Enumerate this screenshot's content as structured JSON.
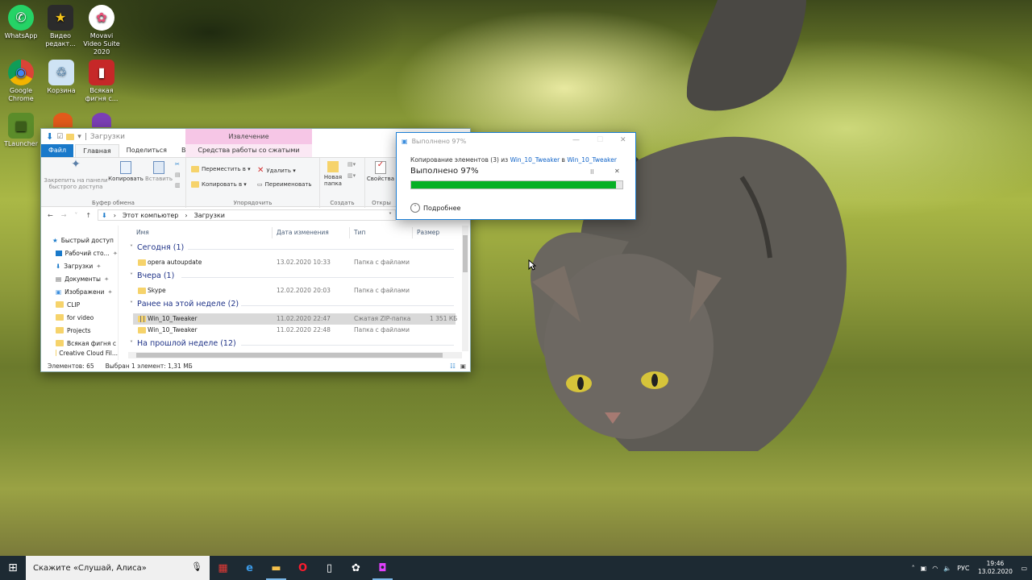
{
  "desktop": {
    "icons": [
      {
        "label": "WhatsApp",
        "glyph": "✆",
        "color": "#25d366"
      },
      {
        "label": "Видео редакт...",
        "glyph": "★",
        "color": "#2b2b2b"
      },
      {
        "label": "Movavi Video Suite 2020",
        "glyph": "✿",
        "color": "#ffffff"
      },
      {
        "label": "Google Chrome",
        "glyph": "◉",
        "color": "#ffffff"
      },
      {
        "label": "Корзина",
        "glyph": "♲",
        "color": "#9fc6e8"
      },
      {
        "label": "Всякая фигня с...",
        "glyph": "▮",
        "color": "#b22"
      },
      {
        "label": "TLauncher",
        "glyph": "■",
        "color": "#5b8c2a"
      }
    ]
  },
  "explorer": {
    "title": "Загрузки",
    "extract_header": "Извлечение",
    "tabs": {
      "file": "Файл",
      "home": "Главная",
      "share": "Поделиться",
      "view": "Вид",
      "zip_tools": "Средства работы со сжатыми папками"
    },
    "ribbon": {
      "pin": "Закрепить на панели быстрого доступа",
      "copy": "Копировать",
      "paste": "Вставить",
      "clipboard_group": "Буфер обмена",
      "move_to": "Переместить в ▾",
      "copy_to": "Копировать в ▾",
      "delete": "Удалить ▾",
      "rename": "Переименовать",
      "organize_group": "Упорядочить",
      "new_folder": "Новая папка",
      "create_group": "Создать",
      "properties": "Свойства",
      "open_group": "Откры"
    },
    "address": {
      "pc": "Этот компьютер",
      "folder": "Загрузки"
    },
    "nav": {
      "quick_access": "Быстрый доступ",
      "items": [
        "Рабочий сто...",
        "Загрузки",
        "Документы",
        "Изображени",
        "CLIP",
        "for video",
        "Projects",
        "Всякая фигня с"
      ],
      "partial": "Creative Cloud Fil..."
    },
    "columns": {
      "name": "Имя",
      "date": "Дата изменения",
      "type": "Тип",
      "size": "Размер"
    },
    "groups": [
      {
        "label": "Сегодня (1)",
        "rows": [
          {
            "name": "opera autoupdate",
            "date": "13.02.2020 10:33",
            "type": "Папка с файлами",
            "size": ""
          }
        ]
      },
      {
        "label": "Вчера (1)",
        "rows": [
          {
            "name": "Skype",
            "date": "12.02.2020 20:03",
            "type": "Папка с файлами",
            "size": ""
          }
        ]
      },
      {
        "label": "Ранее на этой неделе (2)",
        "rows": [
          {
            "name": "Win_10_Tweaker",
            "date": "11.02.2020 22:47",
            "type": "Сжатая ZIP-папка",
            "size": "1 351 КБ"
          },
          {
            "name": "Win_10_Tweaker",
            "date": "11.02.2020 22:48",
            "type": "Папка с файлами",
            "size": ""
          }
        ]
      },
      {
        "label": "На прошлой неделе (12)",
        "rows": []
      }
    ],
    "status": {
      "count": "Элементов: 65",
      "selected": "Выбран 1 элемент: 1,31 МБ"
    }
  },
  "copy_dialog": {
    "title": "Выполнено 97%",
    "line_prefix": "Копирование элементов (3) из",
    "source": "Win_10_Tweaker",
    "line_mid": "в",
    "dest": "Win_10_Tweaker",
    "progress_text": "Выполнено 97%",
    "progress": 0.97,
    "pause": "II",
    "cancel": "✕",
    "details": "Подробнее"
  },
  "taskbar": {
    "search_placeholder": "Скажите «Слушай, Алиса»",
    "apps": [
      {
        "glyph": "▦",
        "color": "#e53935"
      },
      {
        "glyph": "e",
        "color": "#3c9be8"
      },
      {
        "glyph": "▬",
        "color": "#f6c14b"
      },
      {
        "glyph": "O",
        "color": "#ff1b2d"
      },
      {
        "glyph": "▯",
        "color": "#ffffff"
      },
      {
        "glyph": "✿",
        "color": "#ffffff"
      },
      {
        "glyph": "◘",
        "color": "#e040fb"
      }
    ],
    "lang": "РУС",
    "time": "19:46",
    "date": "13.02.2020"
  }
}
